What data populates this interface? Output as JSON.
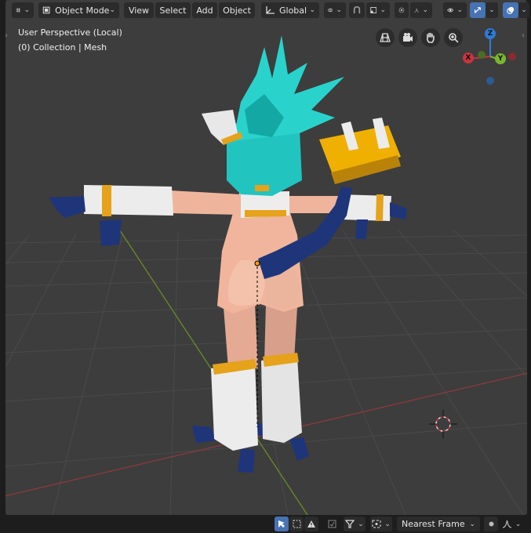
{
  "header": {
    "editor_type_icon": "editor-type-icon",
    "mode_label": "Object Mode",
    "menus": [
      "View",
      "Select",
      "Add",
      "Object"
    ],
    "transform_orientation": "Global",
    "pivot_icon": "pivot-icon",
    "snap_icon": "snap-icon",
    "proportional_icon": "proportional-edit-icon",
    "visibility_icon": "eye-icon",
    "gizmo_icon": "gizmo-icon",
    "overlay_icon": "overlay-icon"
  },
  "viewport": {
    "perspective_label": "User Perspective (Local)",
    "collection_label": "(0) Collection | Mesh",
    "nav_buttons": [
      "grid-view-icon",
      "camera-icon",
      "hand-pan-icon",
      "zoom-icon"
    ],
    "gizmo_axes": {
      "z": "Z",
      "x": "X",
      "y": "Y"
    },
    "colors": {
      "background": "#3d3d3d",
      "x_axis": "#c8343f",
      "y_axis": "#7ab72f",
      "z_axis": "#2f7bd9",
      "accent": "#4772b3"
    }
  },
  "footer": {
    "select_icon": "select-cursor-icon",
    "playback_label": "Nearest Frame",
    "filter_icon": "filter-icon"
  }
}
